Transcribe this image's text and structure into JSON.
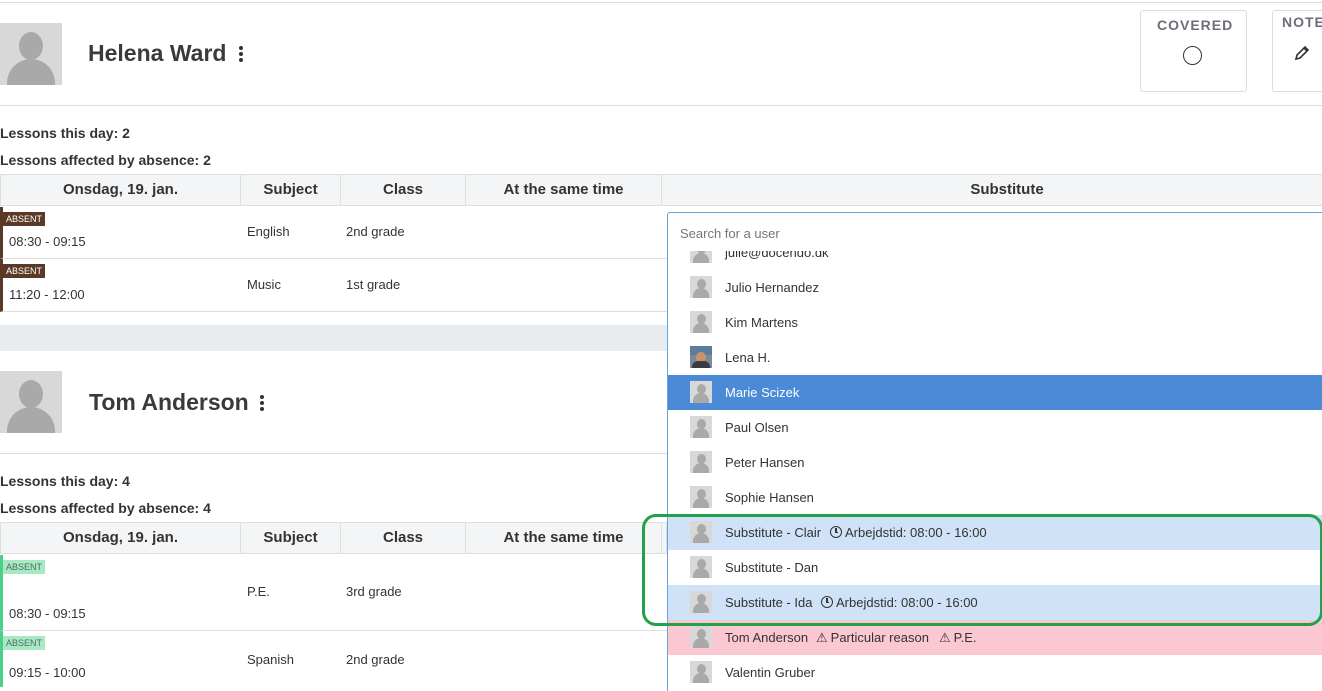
{
  "absences": [
    {
      "name": "Helena Ward",
      "lessons_this_day": "Lessons this day: 2",
      "lessons_affected": "Lessons affected by absence: 2",
      "rows": [
        {
          "badge": "ABSENT",
          "time": "08:30 - 09:15",
          "subject": "English",
          "class": "2nd grade"
        },
        {
          "badge": "ABSENT",
          "time": "11:20 - 12:00",
          "subject": "Music",
          "class": "1st grade"
        }
      ]
    },
    {
      "name": "Tom Anderson",
      "lessons_this_day": "Lessons this day: 4",
      "lessons_affected": "Lessons affected by absence: 4",
      "rows": [
        {
          "badge": "ABSENT",
          "time": "08:30 - 09:15",
          "subject": "P.E.",
          "class": "3rd grade"
        },
        {
          "badge": "ABSENT",
          "time": "09:15 - 10:00",
          "subject": "Spanish",
          "class": "2nd grade"
        }
      ]
    }
  ],
  "table_headers": {
    "date": "Onsdag, 19. jan.",
    "subject": "Subject",
    "class": "Class",
    "same_time": "At the same time",
    "substitute": "Substitute"
  },
  "cards": {
    "covered_label": "COVERED",
    "note_label": "NOTE"
  },
  "dropdown": {
    "placeholder": "Search for a user",
    "items": [
      {
        "name": "julie@docendo.dk"
      },
      {
        "name": "Julio Hernandez"
      },
      {
        "name": "Kim Martens"
      },
      {
        "name": "Lena H."
      },
      {
        "name": "Marie Scizek",
        "state": "selected"
      },
      {
        "name": "Paul Olsen"
      },
      {
        "name": "Peter Hansen"
      },
      {
        "name": "Sophie Hansen"
      },
      {
        "name": "Substitute - Clair",
        "state": "available",
        "extra": "Arbejdstid: 08:00 - 16:00"
      },
      {
        "name": "Substitute - Dan"
      },
      {
        "name": "Substitute - Ida",
        "state": "available",
        "extra": "Arbejdstid: 08:00 - 16:00"
      },
      {
        "name": "Tom Anderson",
        "state": "warning",
        "extra": "Particular reason",
        "extra2": "P.E."
      },
      {
        "name": "Valentin Gruber"
      }
    ]
  },
  "colors": {
    "absent_dark": "#5a3a26",
    "absent_green": "#4bd08a",
    "selected": "#4a8ad6",
    "available": "#cfe2f7",
    "warning": "#fbc8d2",
    "highlight_border": "#22a04a"
  },
  "icons": [
    "kebab-menu-icon",
    "radio-circle-icon",
    "pencil-icon",
    "clock-icon",
    "warning-icon",
    "user-avatar-icon"
  ]
}
